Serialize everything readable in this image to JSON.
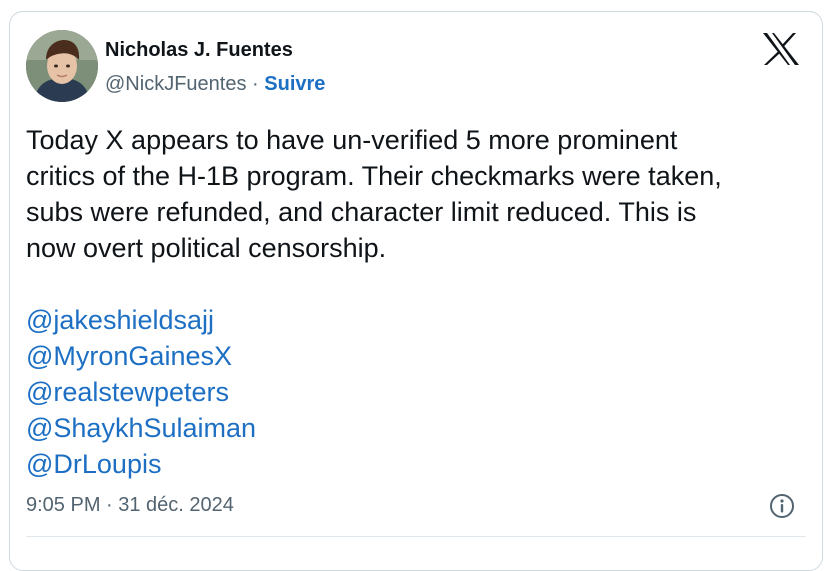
{
  "author": {
    "name": "Nicholas J. Fuentes",
    "handle": "@NickJFuentes",
    "separator": "·",
    "follow_label": "Suivre"
  },
  "platform_icon": "x-logo-icon",
  "tweet": {
    "text_lines": [
      "Today X appears to have un-verified 5 more prominent",
      "critics of the H-1B program. Their checkmarks were taken,",
      "subs were refunded, and character limit reduced. This is",
      "now overt political censorship."
    ],
    "mentions": [
      "@jakeshieldsajj",
      "@MyronGainesX",
      "@realstewpeters",
      "@ShaykhSulaiman",
      "@DrLoupis"
    ]
  },
  "timestamp": "9:05 PM · 31 déc. 2024",
  "info_icon": "info-icon",
  "colors": {
    "link": "#1d6fc4",
    "text": "#0f1419",
    "muted": "#536471",
    "border": "#cfd9de"
  }
}
